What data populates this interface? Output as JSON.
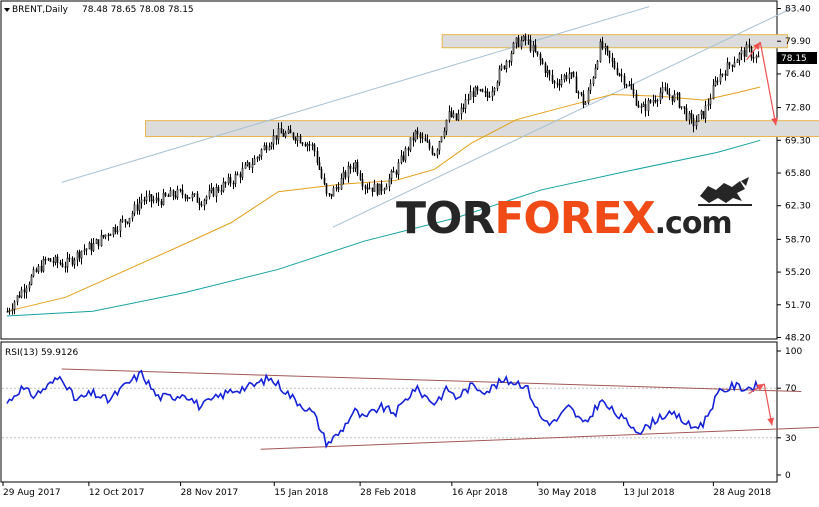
{
  "header": {
    "symbol": "BRENT,Daily",
    "ohlc": "78.48 78.65 78.08 78.15"
  },
  "price_tag": "78.15",
  "rsi_header": "RSI(13) 59.9126",
  "watermark": {
    "part1": "TOR",
    "part2": "FOREX",
    "part3": ".com",
    "icon": "bull-bear-icon"
  },
  "colors": {
    "candle": "#000000",
    "ma_short": "#e3a019",
    "ma_long": "#15a2a2",
    "channel": "#a7c1d2",
    "zone_fill": "#dcdcdc",
    "zone_border": "#e6b44c",
    "arrow": "#ee5050",
    "rsi_line": "#1522d8",
    "rsi_trend": "#a45757",
    "watermark_dark": "#262626",
    "watermark_accent": "#f04a16"
  },
  "chart_data": [
    {
      "type": "candlestick",
      "title": "BRENT,Daily",
      "y_ticks": [
        "83.40",
        "79.90",
        "76.40",
        "72.80",
        "69.30",
        "65.80",
        "62.30",
        "58.70",
        "55.20",
        "51.70",
        "48.20"
      ],
      "ylim": [
        48.2,
        83.4
      ],
      "x_ticks": [
        "29 Aug 2017",
        "12 Oct 2017",
        "28 Nov 2017",
        "15 Jan 2018",
        "28 Feb 2018",
        "16 Apr 2018",
        "30 May 2018",
        "13 Jul 2018",
        "28 Aug 2018"
      ],
      "x_range": [
        "2017-08-29",
        "2018-09-25"
      ],
      "last_price": 78.15,
      "price_path": [
        [
          "2017-08-29",
          51.0
        ],
        [
          "2017-09-08",
          54.0
        ],
        [
          "2017-09-18",
          56.5
        ],
        [
          "2017-09-28",
          56.0
        ],
        [
          "2017-10-06",
          57.5
        ],
        [
          "2017-10-12",
          58.0
        ],
        [
          "2017-10-20",
          59.5
        ],
        [
          "2017-10-30",
          61.0
        ],
        [
          "2017-11-06",
          63.0
        ],
        [
          "2017-11-14",
          62.8
        ],
        [
          "2017-11-22",
          63.5
        ],
        [
          "2017-11-28",
          63.6
        ],
        [
          "2017-12-06",
          62.8
        ],
        [
          "2017-12-14",
          64.0
        ],
        [
          "2017-12-22",
          65.0
        ],
        [
          "2018-01-02",
          67.0
        ],
        [
          "2018-01-10",
          69.2
        ],
        [
          "2018-01-15",
          70.0
        ],
        [
          "2018-01-24",
          69.8
        ],
        [
          "2018-02-02",
          68.5
        ],
        [
          "2018-02-09",
          63.0
        ],
        [
          "2018-02-16",
          65.0
        ],
        [
          "2018-02-23",
          67.0
        ],
        [
          "2018-02-28",
          64.5
        ],
        [
          "2018-03-08",
          64.0
        ],
        [
          "2018-03-16",
          66.0
        ],
        [
          "2018-03-26",
          70.0
        ],
        [
          "2018-04-05",
          68.0
        ],
        [
          "2018-04-12",
          72.0
        ],
        [
          "2018-04-16",
          71.5
        ],
        [
          "2018-04-24",
          74.5
        ],
        [
          "2018-05-02",
          74.0
        ],
        [
          "2018-05-10",
          77.2
        ],
        [
          "2018-05-17",
          79.8
        ],
        [
          "2018-05-22",
          80.0
        ],
        [
          "2018-05-30",
          77.5
        ],
        [
          "2018-06-05",
          75.3
        ],
        [
          "2018-06-13",
          76.5
        ],
        [
          "2018-06-21",
          73.0
        ],
        [
          "2018-06-29",
          79.5
        ],
        [
          "2018-07-05",
          77.5
        ],
        [
          "2018-07-13",
          75.3
        ],
        [
          "2018-07-20",
          72.5
        ],
        [
          "2018-07-30",
          74.5
        ],
        [
          "2018-08-07",
          73.8
        ],
        [
          "2018-08-15",
          71.0
        ],
        [
          "2018-08-21",
          72.2
        ],
        [
          "2018-08-28",
          76.0
        ],
        [
          "2018-09-05",
          77.8
        ],
        [
          "2018-09-12",
          79.0
        ],
        [
          "2018-09-17",
          78.1
        ],
        [
          "2018-09-19",
          78.15
        ]
      ],
      "ma_short_path": [
        [
          "2017-08-29",
          51.0
        ],
        [
          "2017-09-28",
          52.5
        ],
        [
          "2017-10-30",
          55.5
        ],
        [
          "2017-11-28",
          58.2
        ],
        [
          "2017-12-22",
          60.5
        ],
        [
          "2018-01-15",
          63.8
        ],
        [
          "2018-02-16",
          64.6
        ],
        [
          "2018-03-16",
          65.0
        ],
        [
          "2018-04-05",
          66.2
        ],
        [
          "2018-04-24",
          69.0
        ],
        [
          "2018-05-17",
          71.5
        ],
        [
          "2018-06-13",
          73.0
        ],
        [
          "2018-07-05",
          74.2
        ],
        [
          "2018-07-30",
          74.0
        ],
        [
          "2018-08-21",
          73.6
        ],
        [
          "2018-09-05",
          74.3
        ],
        [
          "2018-09-19",
          75.0
        ]
      ],
      "ma_long_path": [
        [
          "2017-08-29",
          50.5
        ],
        [
          "2017-10-12",
          51.0
        ],
        [
          "2017-11-28",
          53.0
        ],
        [
          "2018-01-15",
          55.5
        ],
        [
          "2018-02-28",
          58.5
        ],
        [
          "2018-04-16",
          61.0
        ],
        [
          "2018-05-30",
          64.0
        ],
        [
          "2018-07-13",
          66.0
        ],
        [
          "2018-08-28",
          68.0
        ],
        [
          "2018-09-19",
          69.3
        ]
      ],
      "channel_upper": [
        [
          "2017-09-26",
          64.8
        ],
        [
          "2018-07-24",
          83.6
        ]
      ],
      "channel_lower": [
        [
          "2018-02-12",
          60.0
        ],
        [
          "2018-10-05",
          83.4
        ]
      ],
      "resistance_zone": [
        [
          "2018-04-09",
          79.2
        ],
        [
          "2018-10-03",
          80.6
        ]
      ],
      "support_zone": [
        [
          "2017-11-08",
          69.7
        ],
        [
          "2018-10-24",
          71.4
        ]
      ],
      "forecast_arrows": [
        [
          [
            "2018-09-12",
            77.9
          ],
          [
            "2018-09-19",
            79.8
          ]
        ],
        [
          [
            "2018-09-19",
            79.8
          ],
          [
            "2018-09-27",
            70.9
          ]
        ]
      ]
    },
    {
      "type": "line",
      "title": "RSI(13) 59.9126",
      "y_ticks": [
        "100",
        "70",
        "30",
        "0"
      ],
      "ylim": [
        0,
        100
      ],
      "series": [
        {
          "name": "RSI(13)",
          "values": [
            [
              "2017-08-29",
              58
            ],
            [
              "2017-09-05",
              70
            ],
            [
              "2017-09-12",
              64
            ],
            [
              "2017-09-20",
              73
            ],
            [
              "2017-09-26",
              80
            ],
            [
              "2017-10-03",
              60
            ],
            [
              "2017-10-12",
              66
            ],
            [
              "2017-10-20",
              60
            ],
            [
              "2017-10-30",
              74
            ],
            [
              "2017-11-06",
              82
            ],
            [
              "2017-11-14",
              63
            ],
            [
              "2017-11-22",
              63
            ],
            [
              "2017-11-28",
              66
            ],
            [
              "2017-12-06",
              55
            ],
            [
              "2017-12-14",
              62
            ],
            [
              "2017-12-22",
              68
            ],
            [
              "2018-01-02",
              72
            ],
            [
              "2018-01-10",
              78
            ],
            [
              "2018-01-15",
              73
            ],
            [
              "2018-01-24",
              60
            ],
            [
              "2018-02-02",
              50
            ],
            [
              "2018-02-09",
              25
            ],
            [
              "2018-02-16",
              35
            ],
            [
              "2018-02-23",
              52
            ],
            [
              "2018-02-28",
              45
            ],
            [
              "2018-03-08",
              55
            ],
            [
              "2018-03-16",
              50
            ],
            [
              "2018-03-26",
              70
            ],
            [
              "2018-04-05",
              58
            ],
            [
              "2018-04-12",
              70
            ],
            [
              "2018-04-16",
              62
            ],
            [
              "2018-04-24",
              72
            ],
            [
              "2018-05-02",
              68
            ],
            [
              "2018-05-10",
              76
            ],
            [
              "2018-05-17",
              75
            ],
            [
              "2018-05-22",
              72
            ],
            [
              "2018-05-30",
              45
            ],
            [
              "2018-06-05",
              42
            ],
            [
              "2018-06-13",
              55
            ],
            [
              "2018-06-21",
              40
            ],
            [
              "2018-06-29",
              60
            ],
            [
              "2018-07-05",
              52
            ],
            [
              "2018-07-13",
              42
            ],
            [
              "2018-07-20",
              35
            ],
            [
              "2018-07-30",
              48
            ],
            [
              "2018-08-07",
              48
            ],
            [
              "2018-08-15",
              38
            ],
            [
              "2018-08-21",
              42
            ],
            [
              "2018-08-28",
              65
            ],
            [
              "2018-09-05",
              72
            ],
            [
              "2018-09-12",
              70
            ],
            [
              "2018-09-17",
              72
            ],
            [
              "2018-09-19",
              60
            ]
          ]
        }
      ],
      "trend_upper": [
        [
          "2017-09-26",
          85.5
        ],
        [
          "2018-10-10",
          67.3
        ]
      ],
      "trend_lower": [
        [
          "2018-01-06",
          20.8
        ],
        [
          "2018-10-25",
          38.8
        ]
      ],
      "forecast_arrows": [
        [
          [
            "2018-09-13",
            65.6
          ],
          [
            "2018-09-21",
            73.5
          ]
        ],
        [
          [
            "2018-09-21",
            73.5
          ],
          [
            "2018-09-25",
            40.0
          ]
        ]
      ]
    }
  ]
}
